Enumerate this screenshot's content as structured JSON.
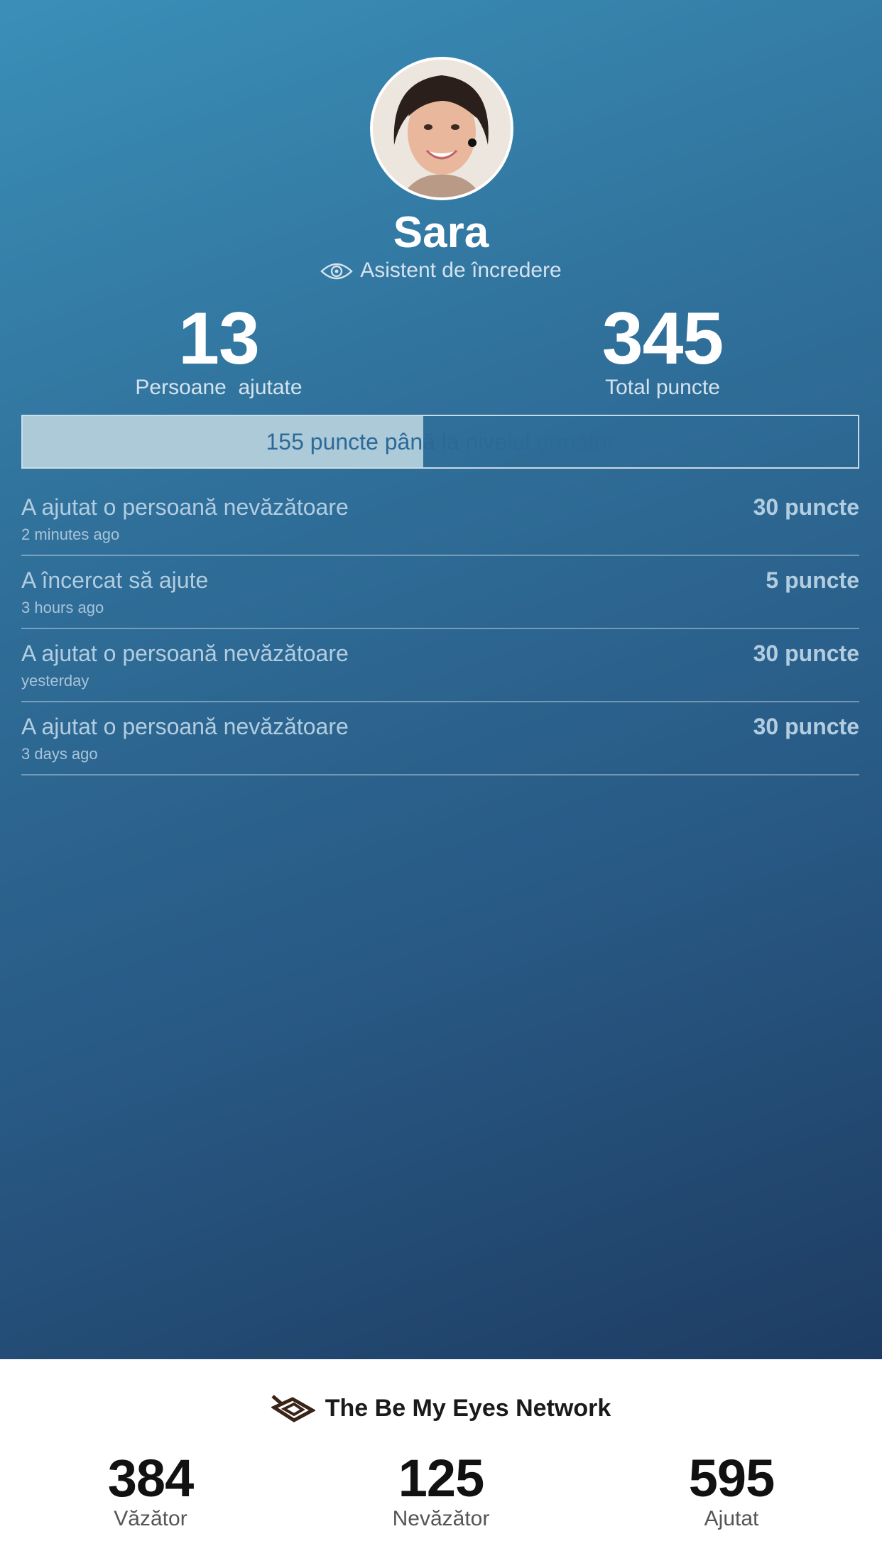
{
  "profile": {
    "name": "Sara",
    "role": "Asistent de încredere",
    "avatar_icon": "user-photo"
  },
  "stats": {
    "helped_value": "13",
    "helped_label": "Persoane  ajutate",
    "points_value": "345",
    "points_label": "Total puncte"
  },
  "progress": {
    "text": "155 puncte până la nivelul următor",
    "fraction": 0.48,
    "fill_color": "#adcad9"
  },
  "history": [
    {
      "title": "A ajutat o persoană nevăzătoare",
      "time": "2 minutes ago",
      "points": "30 puncte"
    },
    {
      "title": "A încercat să ajute",
      "time": "3 hours ago",
      "points": "5 puncte"
    },
    {
      "title": "A ajutat o persoană nevăzătoare",
      "time": "yesterday",
      "points": "30 puncte"
    },
    {
      "title": "A ajutat o persoană nevăzătoare",
      "time": "3 days ago",
      "points": "30 puncte"
    }
  ],
  "network": {
    "title": "The Be My Eyes Network",
    "logo_icon": "be-my-eyes-logo",
    "sighted_value": "384",
    "sighted_label": "Văzător",
    "blind_value": "125",
    "blind_label": "Nevăzător",
    "helped_value": "595",
    "helped_label": "Ajutat"
  },
  "colors": {
    "gradient_start": "#3a8fb8",
    "gradient_end": "#1e3c63"
  }
}
